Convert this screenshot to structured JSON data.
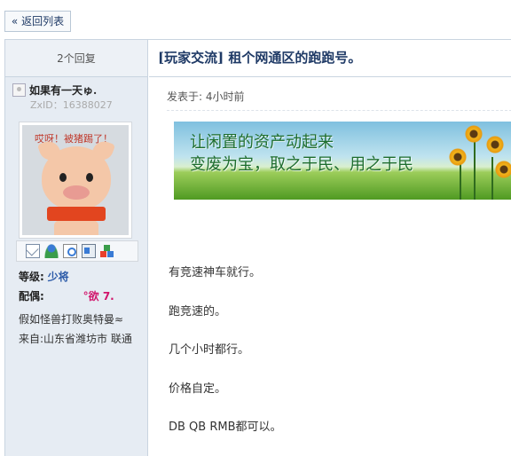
{
  "toolbar": {
    "back_label": "« 返回列表"
  },
  "sidebar": {
    "reply_count": "2个回复",
    "author": {
      "name": "如果有一天ゅ.",
      "zxid": "ZxID：16388027",
      "avatar_caption": "哎呀！被猪踢了！"
    },
    "stats": {
      "rank_key": "等级:",
      "rank_value": "少将",
      "spouse_key": "配偶:",
      "spouse_value": "°欲 7.",
      "signature": "假如怪兽打败奥特曼≈",
      "location": "来自:山东省潍坊市 联通"
    },
    "icons": [
      "mail-icon",
      "add-friend-icon",
      "search-posts-icon",
      "profile-card-icon",
      "blocks-icon"
    ]
  },
  "post": {
    "title": "[玩家交流] 租个网通区的跑跑号。",
    "posted_time": "发表于: 4小时前",
    "banner": {
      "line1": "让闲置的资产动起来",
      "line2": "变废为宝，取之于民、用之于民"
    },
    "lines": [
      "有竞速神车就行。",
      "跑竞速的。",
      "几个小时都行。",
      "价格自定。",
      "DB QB RMB都可以。"
    ]
  },
  "colors": {
    "sidebar_bg": "#e6ecf3",
    "title_color": "#1f3a66",
    "rank_color": "#2b5aa8",
    "spouse_color": "#d1156b"
  }
}
